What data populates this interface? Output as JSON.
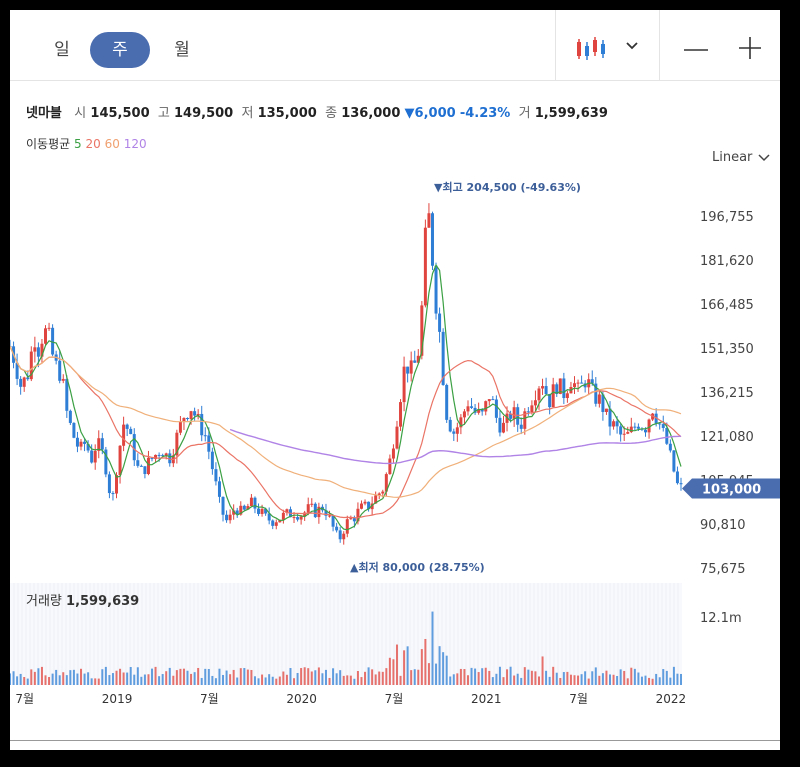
{
  "periods": {
    "day": "일",
    "week": "주",
    "month": "월"
  },
  "quote": {
    "name": "넷마블",
    "open_label": "시",
    "open": "145,500",
    "high_label": "고",
    "high": "149,500",
    "low_label": "저",
    "low": "135,000",
    "close_label": "종",
    "close": "136,000",
    "change": "▼6,000",
    "change_pct": "-4.23%",
    "volume_label": "거",
    "volume": "1,599,639"
  },
  "ma": {
    "label": "이동평균",
    "p5": "5",
    "p20": "20",
    "p60": "60",
    "p120": "120"
  },
  "scale_mode": "Linear",
  "colors": {
    "up": "#e0443e",
    "down": "#2e7ed6",
    "ma5": "#3ba043",
    "ma20": "#ea7466",
    "ma60": "#f0b07a",
    "ma120": "#b083e6",
    "accent": "#4a6db0",
    "annotation": "#3d5f99"
  },
  "chart_data": {
    "type": "candlestick",
    "y_ticks": [
      "196,755",
      "181,620",
      "166,485",
      "151,350",
      "136,215",
      "121,080",
      "105,945",
      "90,810",
      "75,675"
    ],
    "y_tick_values": [
      196755,
      181620,
      166485,
      151350,
      136215,
      121080,
      105945,
      90810,
      75675
    ],
    "x_ticks": [
      "7월",
      "2019",
      "7월",
      "2020",
      "7월",
      "2021",
      "7월",
      "2022"
    ],
    "high_annotation": "▼최고 204,500 (-49.63%)",
    "low_annotation": "▲최저 80,000 (28.75%)",
    "last_price_label": "103,000",
    "last_price": 103000,
    "price_path": [
      [
        2018.42,
        152000
      ],
      [
        2018.45,
        146000
      ],
      [
        2018.48,
        138000
      ],
      [
        2018.52,
        143000
      ],
      [
        2018.55,
        156000
      ],
      [
        2018.58,
        150000
      ],
      [
        2018.6,
        158000
      ],
      [
        2018.63,
        155000
      ],
      [
        2018.66,
        146000
      ],
      [
        2018.7,
        142000
      ],
      [
        2018.73,
        128000
      ],
      [
        2018.77,
        120000
      ],
      [
        2018.8,
        116000
      ],
      [
        2018.83,
        119000
      ],
      [
        2018.86,
        113000
      ],
      [
        2018.89,
        119000
      ],
      [
        2018.92,
        115000
      ],
      [
        2018.95,
        108000
      ],
      [
        2018.97,
        96000
      ],
      [
        2019.0,
        112000
      ],
      [
        2019.04,
        127000
      ],
      [
        2019.08,
        118000
      ],
      [
        2019.12,
        108000
      ],
      [
        2019.16,
        111000
      ],
      [
        2019.2,
        114000
      ],
      [
        2019.24,
        117000
      ],
      [
        2019.28,
        113000
      ],
      [
        2019.32,
        120000
      ],
      [
        2019.36,
        128000
      ],
      [
        2019.4,
        131000
      ],
      [
        2019.44,
        126000
      ],
      [
        2019.48,
        121000
      ],
      [
        2019.52,
        109000
      ],
      [
        2019.56,
        96000
      ],
      [
        2019.6,
        91000
      ],
      [
        2019.64,
        97000
      ],
      [
        2019.68,
        94000
      ],
      [
        2019.72,
        98000
      ],
      [
        2019.76,
        96000
      ],
      [
        2019.8,
        93000
      ],
      [
        2019.84,
        92000
      ],
      [
        2019.88,
        93000
      ],
      [
        2019.92,
        94000
      ],
      [
        2019.96,
        95000
      ],
      [
        2020.0,
        94000
      ],
      [
        2020.04,
        96000
      ],
      [
        2020.08,
        95000
      ],
      [
        2020.12,
        97000
      ],
      [
        2020.16,
        91000
      ],
      [
        2020.2,
        85000
      ],
      [
        2020.24,
        91000
      ],
      [
        2020.28,
        93000
      ],
      [
        2020.32,
        96000
      ],
      [
        2020.36,
        97000
      ],
      [
        2020.4,
        100000
      ],
      [
        2020.44,
        103000
      ],
      [
        2020.48,
        113000
      ],
      [
        2020.52,
        129000
      ],
      [
        2020.56,
        146000
      ],
      [
        2020.6,
        143000
      ],
      [
        2020.64,
        152000
      ],
      [
        2020.66,
        176000
      ],
      [
        2020.68,
        201000
      ],
      [
        2020.7,
        190000
      ],
      [
        2020.72,
        171000
      ],
      [
        2020.75,
        155000
      ],
      [
        2020.78,
        130000
      ],
      [
        2020.82,
        122000
      ],
      [
        2020.86,
        126000
      ],
      [
        2020.9,
        133000
      ],
      [
        2020.94,
        129000
      ],
      [
        2020.98,
        128000
      ],
      [
        2021.02,
        136000
      ],
      [
        2021.06,
        126000
      ],
      [
        2021.1,
        124000
      ],
      [
        2021.14,
        130000
      ],
      [
        2021.18,
        124000
      ],
      [
        2021.22,
        131000
      ],
      [
        2021.26,
        136000
      ],
      [
        2021.3,
        141000
      ],
      [
        2021.34,
        133000
      ],
      [
        2021.38,
        139000
      ],
      [
        2021.42,
        136000
      ],
      [
        2021.46,
        141000
      ],
      [
        2021.5,
        136000
      ],
      [
        2021.54,
        141000
      ],
      [
        2021.58,
        135000
      ],
      [
        2021.62,
        133000
      ],
      [
        2021.66,
        126000
      ],
      [
        2021.7,
        124000
      ],
      [
        2021.74,
        120000
      ],
      [
        2021.78,
        122000
      ],
      [
        2021.82,
        126000
      ],
      [
        2021.86,
        124000
      ],
      [
        2021.9,
        131000
      ],
      [
        2021.94,
        125000
      ],
      [
        2021.98,
        118000
      ],
      [
        2022.02,
        108000
      ],
      [
        2022.04,
        103000
      ]
    ],
    "volume_label": "거래량",
    "volume_value": "1,599,639",
    "volume_axis_tick": "12.1m"
  }
}
